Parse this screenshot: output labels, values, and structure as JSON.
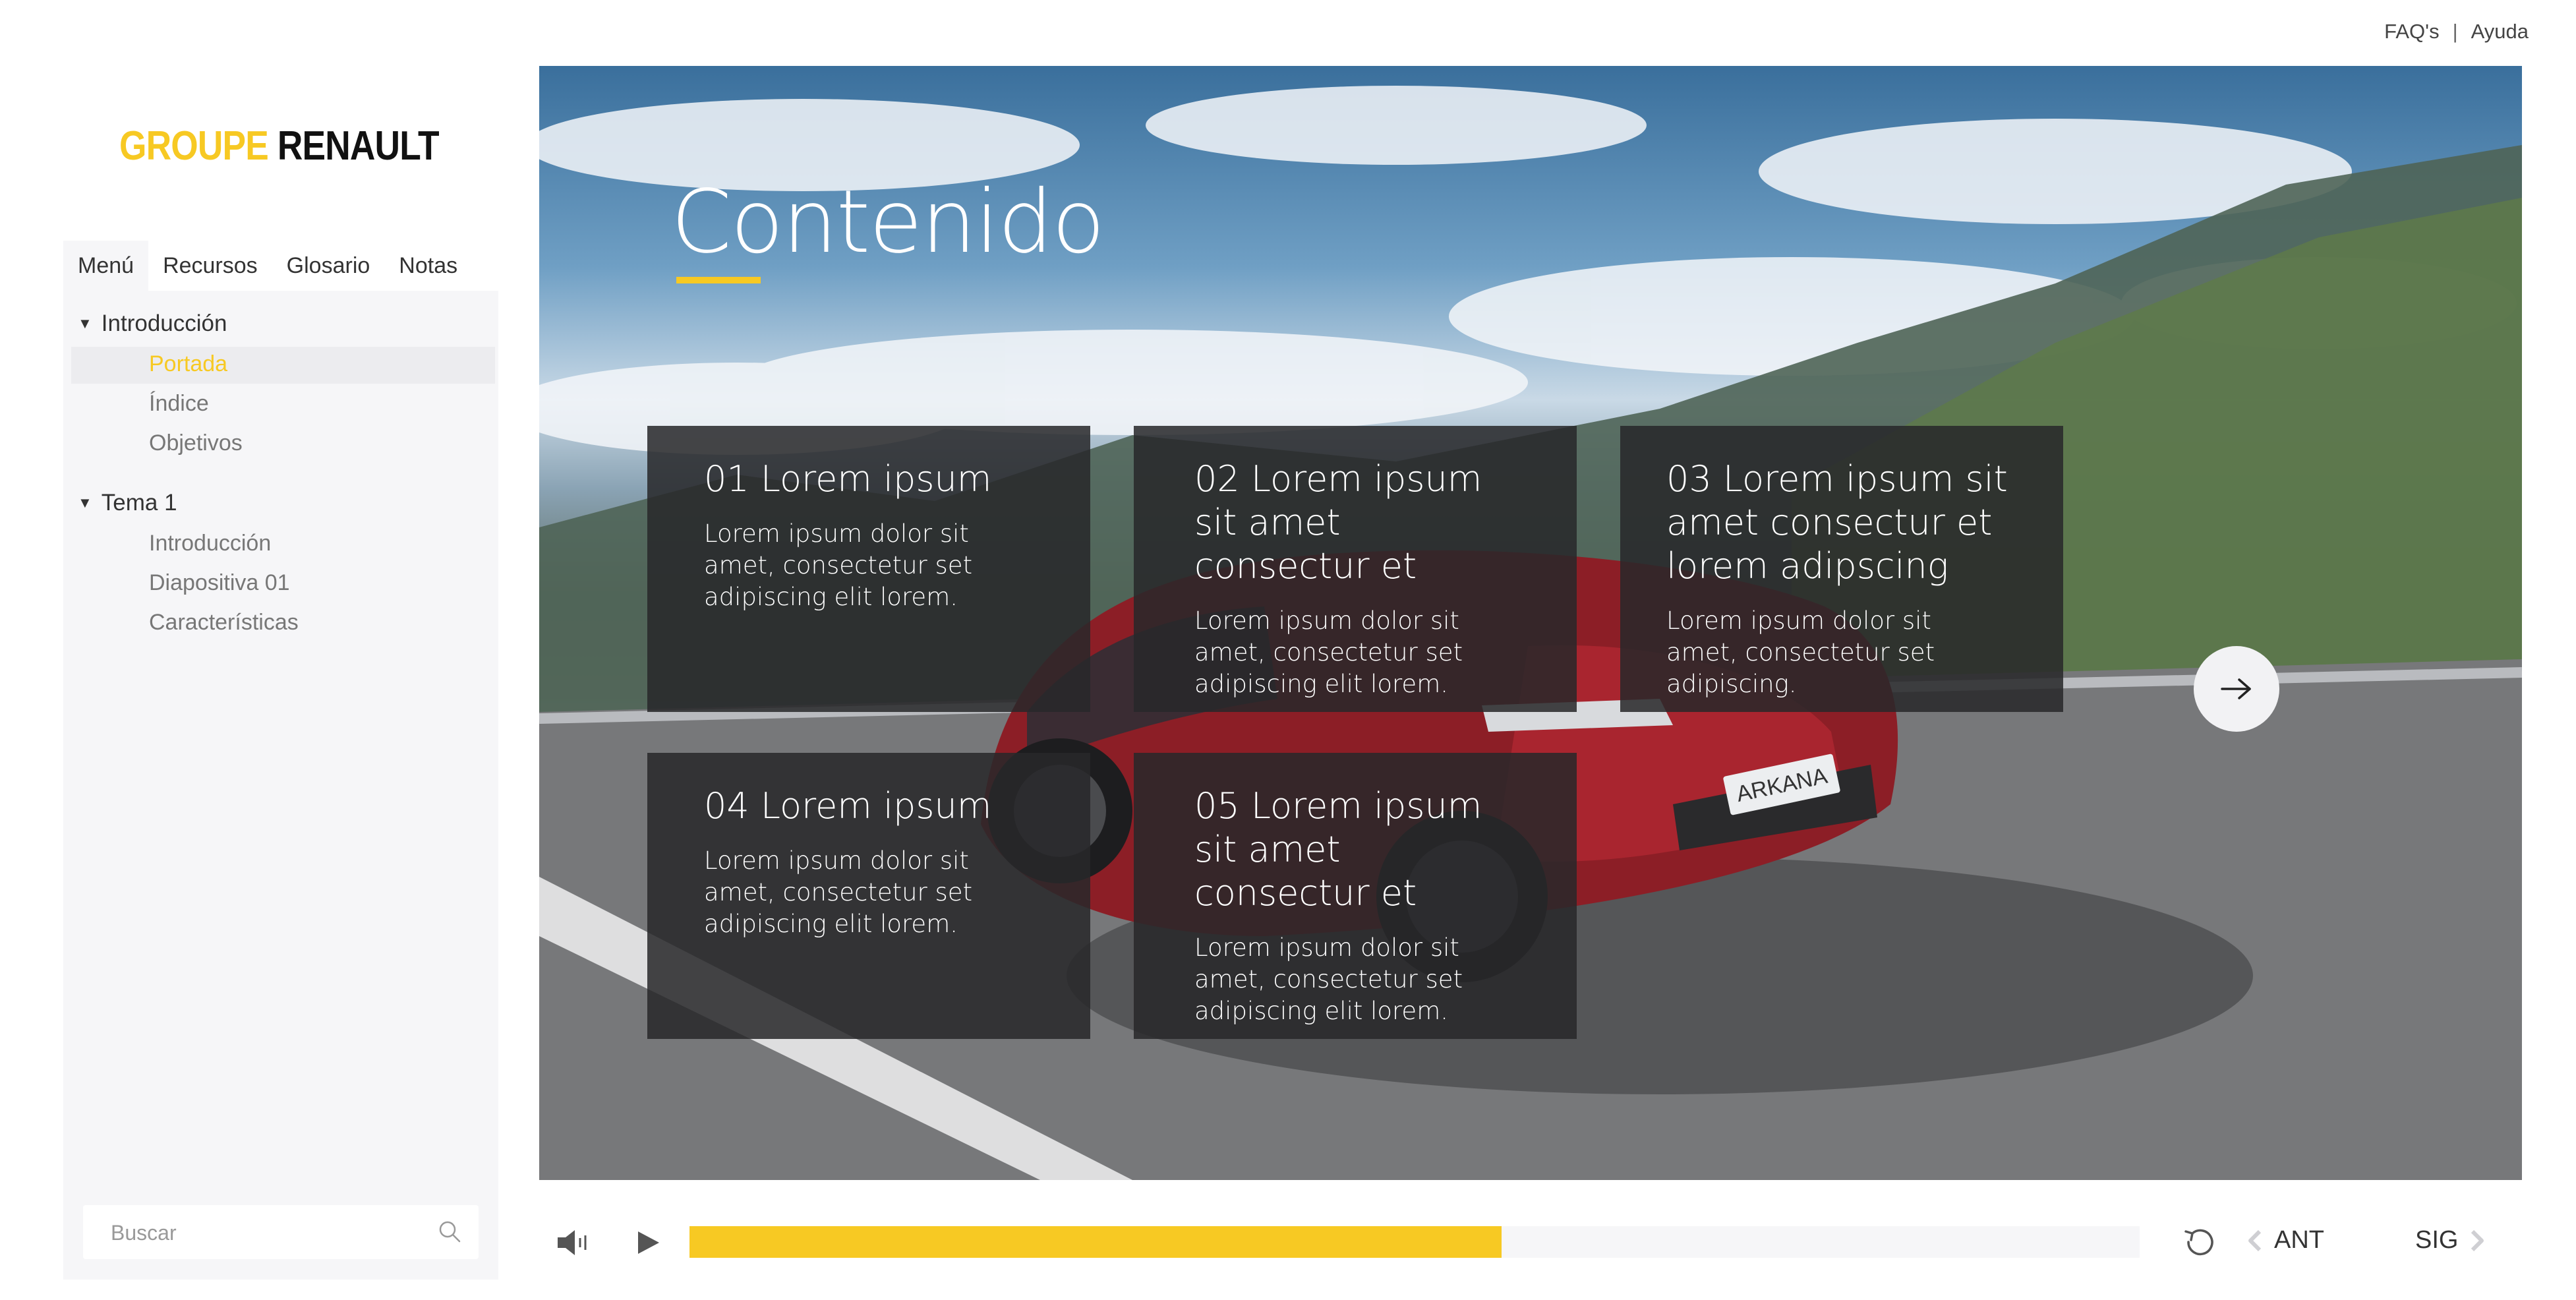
{
  "top_links": {
    "faq": "FAQ's",
    "separator": "|",
    "help": "Ayuda"
  },
  "logo": {
    "part1": "GROUPE",
    "part2": "RENAULT"
  },
  "tabs": [
    {
      "label": "Menú"
    },
    {
      "label": "Recursos"
    },
    {
      "label": "Glosario"
    },
    {
      "label": "Notas"
    }
  ],
  "menu": {
    "groups": [
      {
        "label": "Introducción",
        "items": [
          "Portada",
          "Índice",
          "Objetivos"
        ]
      },
      {
        "label": "Tema 1",
        "items": [
          "Introducción",
          "Diapositiva 01",
          "Características"
        ]
      }
    ],
    "active_item": "Portada"
  },
  "search": {
    "placeholder": "Buscar"
  },
  "hero": {
    "title": "Contenido",
    "cards": [
      {
        "title": "01 Lorem ipsum",
        "text": "Lorem ipsum dolor sit amet, consectetur set adipiscing elit lorem."
      },
      {
        "title": "02 Lorem ipsum sit amet consectur et",
        "text": "Lorem ipsum dolor sit amet, consectetur set adipiscing elit lorem."
      },
      {
        "title": "03 Lorem ipsum sit amet consectur et lorem adipscing",
        "text": "Lorem ipsum dolor sit amet, consectetur set adipiscing."
      },
      {
        "title": "04 Lorem ipsum",
        "text": "Lorem ipsum dolor sit amet, consectetur set adipiscing elit lorem."
      },
      {
        "title": "05 Lorem ipsum sit amet consectur et",
        "text": "Lorem ipsum dolor sit amet, consectetur set adipiscing elit lorem."
      }
    ],
    "plate_text": "ARKANA"
  },
  "player": {
    "progress_percent": 56,
    "prev_label": "ANT",
    "next_label": "SIG"
  },
  "colors": {
    "accent": "#f7c923",
    "card_bg": "#28282a",
    "panel_bg": "#f6f6f8"
  },
  "icons": [
    "volume-icon",
    "play-icon",
    "reload-icon",
    "chevron-left-icon",
    "chevron-right-icon",
    "arrow-right-icon",
    "search-icon"
  ]
}
